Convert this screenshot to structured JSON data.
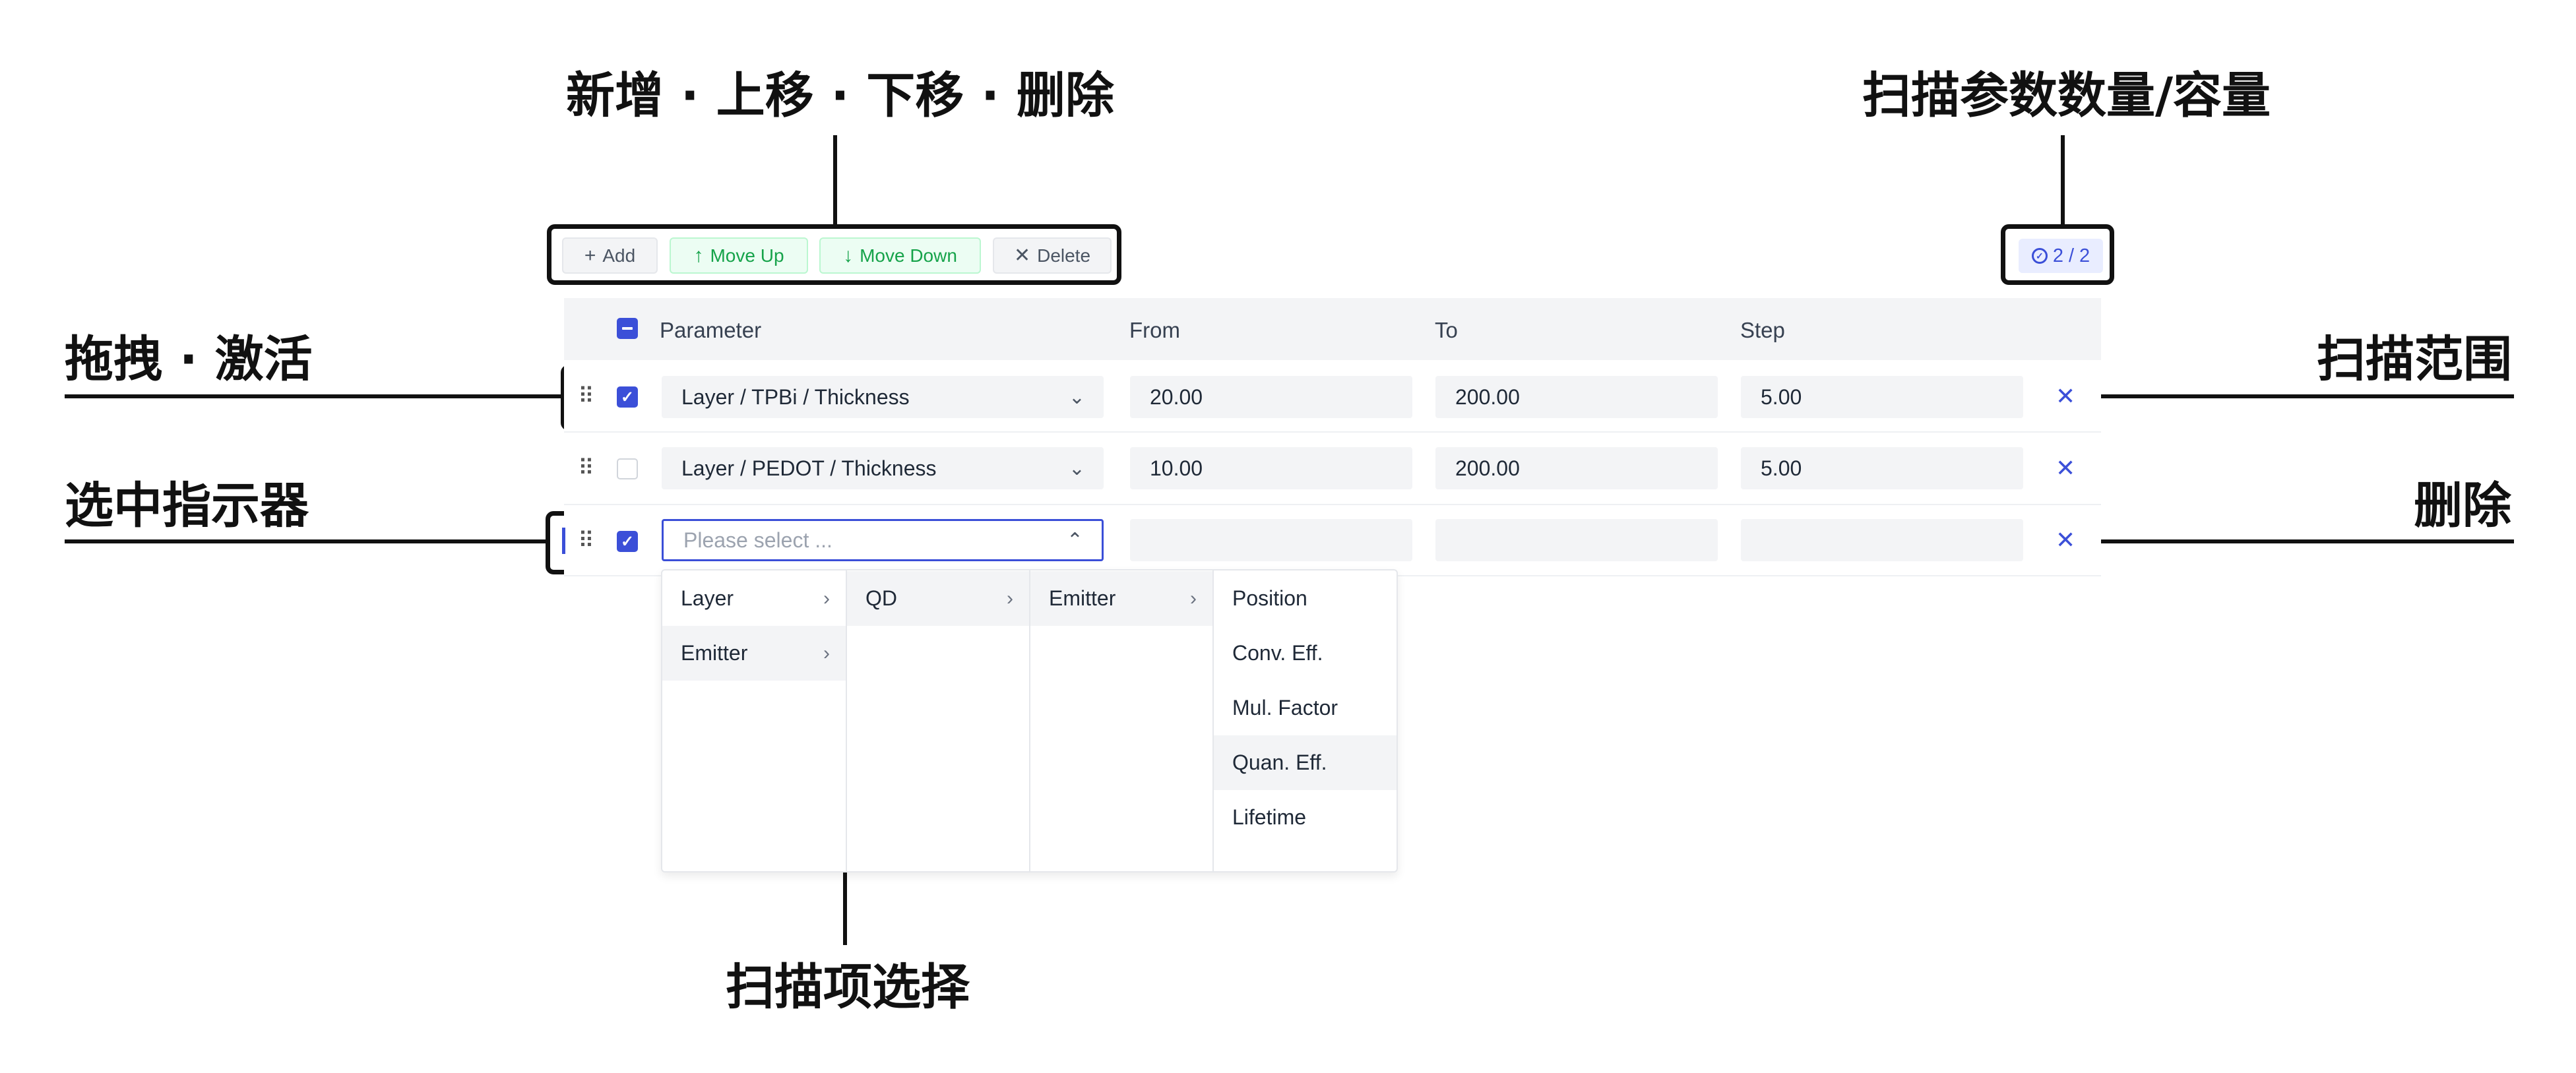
{
  "annotations": {
    "toolbar_group": "新增 · 上移 · 下移 · 删除",
    "capacity": "扫描参数数量/容量",
    "drag_activate": "拖拽 · 激活",
    "scan_range": "扫描范围",
    "selected_indicator": "选中指示器",
    "delete": "删除",
    "item_select": "扫描项选择"
  },
  "toolbar": {
    "add_label": "Add",
    "move_up_label": "Move Up",
    "move_down_label": "Move Down",
    "delete_label": "Delete"
  },
  "capacity_badge": {
    "used": "2",
    "separator": "/",
    "total": "2"
  },
  "table": {
    "headers": {
      "parameter": "Parameter",
      "from": "From",
      "to": "To",
      "step": "Step"
    },
    "rows": [
      {
        "checked": true,
        "parameter": "Layer / TPBi / Thickness",
        "from": "20.00",
        "to": "200.00",
        "step": "5.00"
      },
      {
        "checked": false,
        "parameter": "Layer / PEDOT / Thickness",
        "from": "10.00",
        "to": "200.00",
        "step": "5.00"
      },
      {
        "checked": true,
        "parameter": "",
        "placeholder": "Please select ...",
        "from": "",
        "to": "",
        "step": ""
      }
    ]
  },
  "cascader": {
    "col1": [
      "Layer",
      "Emitter"
    ],
    "col2": [
      "QD"
    ],
    "col3": [
      "Emitter"
    ],
    "col4": [
      "Position",
      "Conv. Eff.",
      "Mul. Factor",
      "Quan. Eff.",
      "Lifetime"
    ]
  },
  "colors": {
    "accent": "#3b4fd8",
    "green": "#16a34a",
    "field_bg": "#f3f4f6"
  }
}
